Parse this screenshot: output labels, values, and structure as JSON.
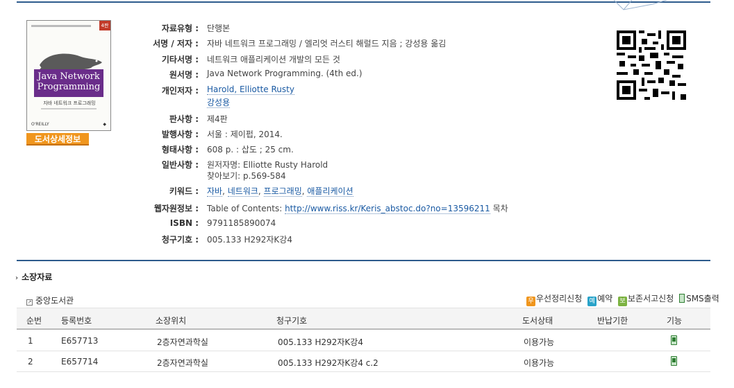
{
  "book": {
    "cover_title": "Java Network Programming",
    "cover_subtitle": "자바 네트워크 프로그래밍",
    "cover_edition_badge": "4판",
    "cover_publisher": "O'REILLY",
    "detail_button": "도서상세정보"
  },
  "fields": [
    {
      "label": "자료유형 :",
      "value": "단행본"
    },
    {
      "label": "서명 / 저자 :",
      "value": "자바 네트워크 프로그래밍 / 엘리엇 러스티 해럴드 지음 ; 강성용 옮김"
    },
    {
      "label": "기타서명 :",
      "value": "네트워크 애플리케이션 개발의 모든 것"
    },
    {
      "label": "원서명 :",
      "value": "Java Network Programming. (4th ed.)"
    },
    {
      "label": "개인저자 :",
      "links": [
        "Harold, Elliotte Rusty",
        "강성용"
      ]
    },
    {
      "label": "판사항 :",
      "value": "제4판"
    },
    {
      "label": "발행사항 :",
      "value": "서울 : 제이펍, 2014."
    },
    {
      "label": "형태사항 :",
      "value": "608 p. : 삽도 ; 25 cm."
    },
    {
      "label": "일반사항 :",
      "value": "원저자명: Elliotte Rusty Harold",
      "value2": "찾아보기: p.569-584"
    },
    {
      "label": "키워드 :",
      "keywords": [
        "자바",
        "네트워크",
        "프로그래밍",
        "애플리케이션"
      ]
    },
    {
      "label": "웹자원정보 :",
      "prefix": "Table of Contents:",
      "url": "http://www.riss.kr/Keris_abstoc.do?no=13596211",
      "suffix": "목차"
    },
    {
      "label": "ISBN :",
      "value": "9791185890074"
    },
    {
      "label": "청구기호 :",
      "value": "005.133 H292자K강4"
    }
  ],
  "holdings": {
    "section_title": "소장자료",
    "library": "중앙도서관",
    "actions": [
      {
        "badge": "우",
        "label": "우선정리신청",
        "color": "#f0961e"
      },
      {
        "badge": "예",
        "label": "예약",
        "color": "#29a3c9"
      },
      {
        "badge": "보",
        "label": "보존서고신청",
        "color": "#7cb342"
      },
      {
        "badge": "",
        "label": "SMS출력",
        "color": "#2e7d32"
      }
    ],
    "columns": [
      "순번",
      "등록번호",
      "소장위치",
      "청구기호",
      "도서상태",
      "반납기한",
      "기능"
    ],
    "rows": [
      {
        "no": "1",
        "reg": "E657713",
        "loc": "2층자연과학실",
        "call": "005.133 H292자K강4",
        "status": "이용가능",
        "due": ""
      },
      {
        "no": "2",
        "reg": "E657714",
        "loc": "2층자연과학실",
        "call": "005.133 H292자K강4 c.2",
        "status": "이용가능",
        "due": ""
      }
    ]
  }
}
